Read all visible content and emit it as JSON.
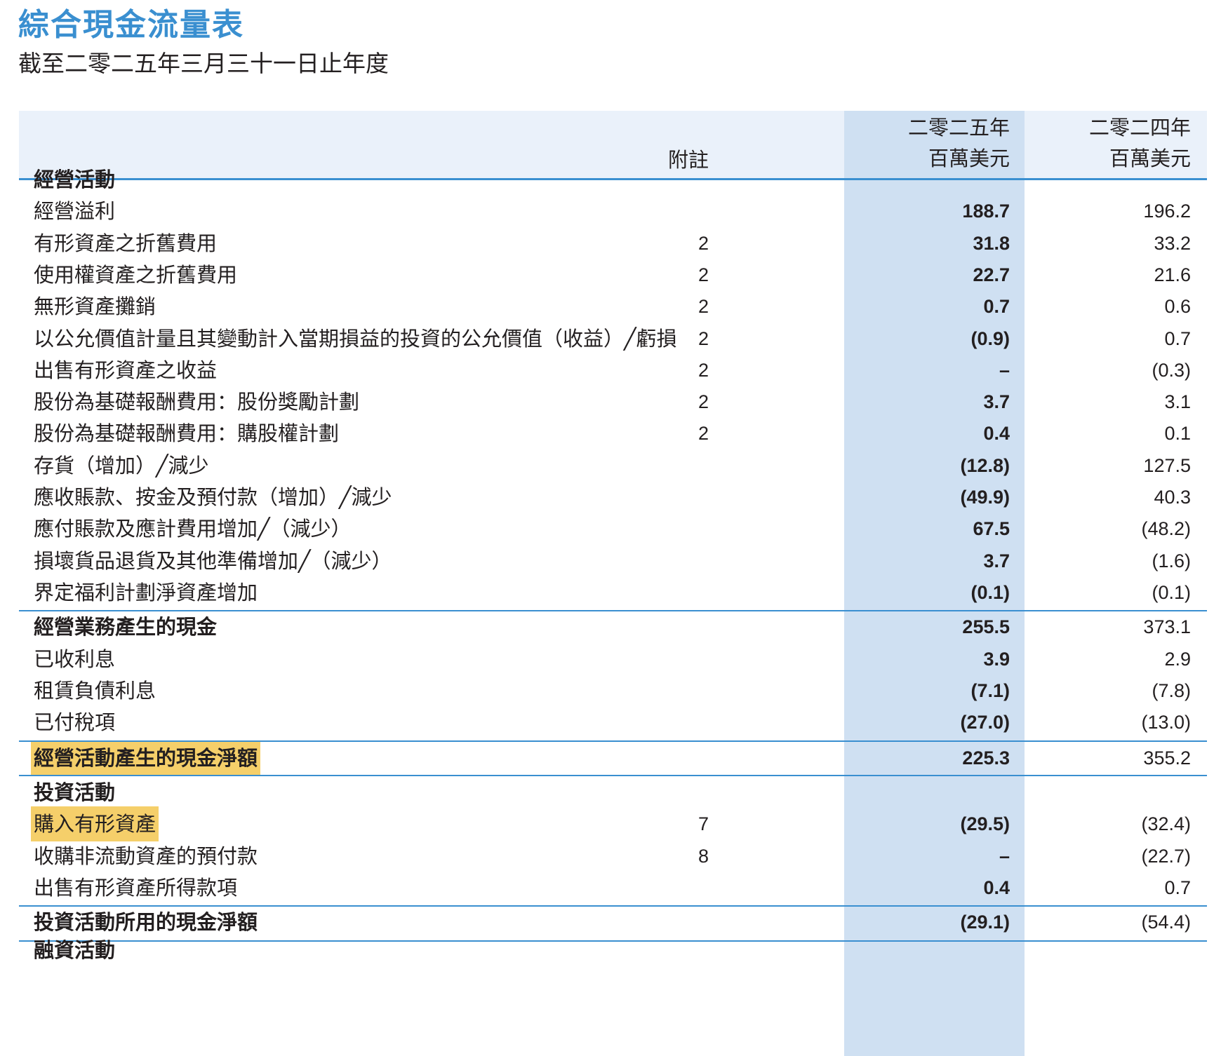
{
  "page": {
    "title": "綜合現金流量表",
    "subtitle": "截至二零二五年三月三十一日止年度"
  },
  "header": {
    "note_label": "附註",
    "current_year": "二零二五年",
    "current_unit": "百萬美元",
    "prior_year": "二零二四年",
    "prior_unit": "百萬美元"
  },
  "rows": [
    {
      "label": "經營活動",
      "note": "",
      "cur": "",
      "prior": "",
      "bold": true
    },
    {
      "label": "經營溢利",
      "note": "",
      "cur": "188.7",
      "prior": "196.2"
    },
    {
      "label": "有形資產之折舊費用",
      "note": "2",
      "cur": "31.8",
      "prior": "33.2"
    },
    {
      "label": "使用權資產之折舊費用",
      "note": "2",
      "cur": "22.7",
      "prior": "21.6"
    },
    {
      "label": "無形資產攤銷",
      "note": "2",
      "cur": "0.7",
      "prior": "0.6"
    },
    {
      "label": "以公允價值計量且其變動計入當期損益的投資的公允價值（收益）╱虧損",
      "note": "2",
      "cur": "(0.9)",
      "prior": "0.7"
    },
    {
      "label": "出售有形資產之收益",
      "note": "2",
      "cur": "–",
      "prior": "(0.3)"
    },
    {
      "label": "股份為基礎報酬費用：股份獎勵計劃",
      "note": "2",
      "cur": "3.7",
      "prior": "3.1"
    },
    {
      "label": "股份為基礎報酬費用：購股權計劃",
      "note": "2",
      "cur": "0.4",
      "prior": "0.1"
    },
    {
      "label": "存貨（增加）╱減少",
      "note": "",
      "cur": "(12.8)",
      "prior": "127.5"
    },
    {
      "label": "應收賬款、按金及預付款（增加）╱減少",
      "note": "",
      "cur": "(49.9)",
      "prior": "40.3"
    },
    {
      "label": "應付賬款及應計費用增加╱（減少）",
      "note": "",
      "cur": "67.5",
      "prior": "(48.2)"
    },
    {
      "label": "損壞貨品退貨及其他準備增加╱（減少）",
      "note": "",
      "cur": "3.7",
      "prior": "(1.6)"
    },
    {
      "label": "界定福利計劃淨資產增加",
      "note": "",
      "cur": "(0.1)",
      "prior": "(0.1)"
    },
    {
      "label": "經營業務產生的現金",
      "note": "",
      "cur": "255.5",
      "prior": "373.1",
      "bold": true
    },
    {
      "label": "已收利息",
      "note": "",
      "cur": "3.9",
      "prior": "2.9"
    },
    {
      "label": "租賃負債利息",
      "note": "",
      "cur": "(7.1)",
      "prior": "(7.8)"
    },
    {
      "label": "已付稅項",
      "note": "",
      "cur": "(27.0)",
      "prior": "(13.0)"
    },
    {
      "label": "經營活動產生的現金淨額",
      "note": "",
      "cur": "225.3",
      "prior": "355.2",
      "bold": true,
      "highlight": true
    },
    {
      "label": "投資活動",
      "note": "",
      "cur": "",
      "prior": "",
      "bold": true
    },
    {
      "label": "購入有形資產",
      "note": "7",
      "cur": "(29.5)",
      "prior": "(32.4)",
      "highlight": true
    },
    {
      "label": "收購非流動資產的預付款",
      "note": "8",
      "cur": "–",
      "prior": "(22.7)"
    },
    {
      "label": "出售有形資產所得款項",
      "note": "",
      "cur": "0.4",
      "prior": "0.7"
    },
    {
      "label": "投資活動所用的現金淨額",
      "note": "",
      "cur": "(29.1)",
      "prior": "(54.4)",
      "bold": true
    }
  ],
  "next_section": "融資活動"
}
